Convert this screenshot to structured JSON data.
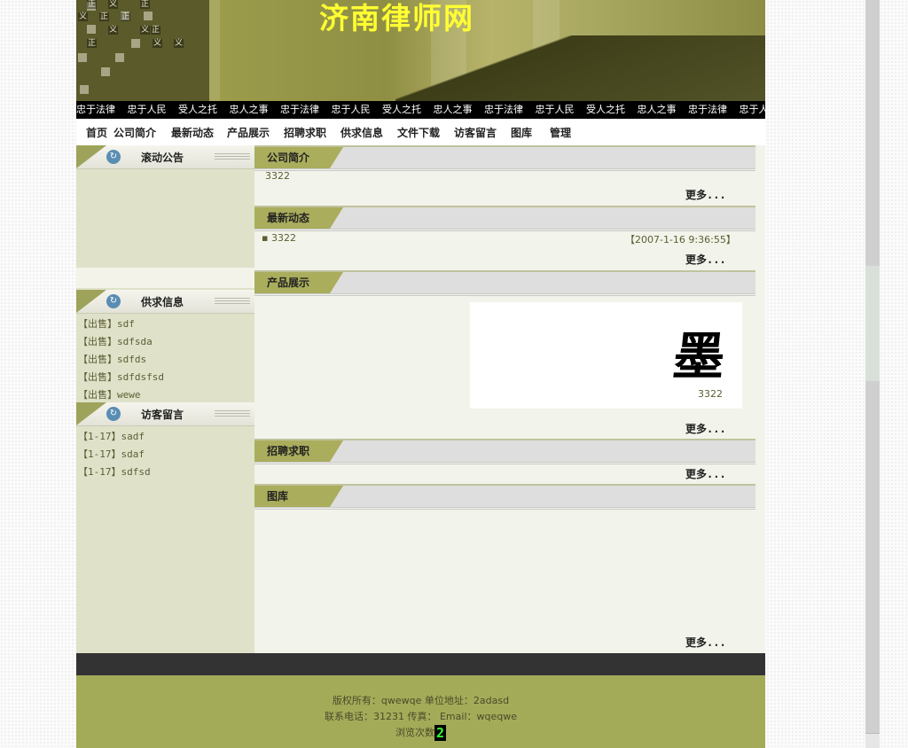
{
  "site": {
    "title": "济南律师网"
  },
  "banner": {
    "chips": [
      "正",
      "义",
      "正",
      "义",
      "正",
      "正",
      "义",
      "义",
      "正",
      "正",
      "义",
      "义"
    ]
  },
  "marquee": {
    "items": [
      "忠于法律",
      "忠于人民",
      "受人之托",
      "忠人之事",
      "忠于法律",
      "忠于人民",
      "受人之托",
      "忠人之事",
      "忠于法律",
      "忠于人民",
      "受人之托",
      "忠人之事",
      "忠于法律",
      "忠于人民",
      "受"
    ]
  },
  "nav": {
    "items": [
      "首页",
      "公司简介",
      "最新动态",
      "产品展示",
      "招聘求职",
      "供求信息",
      "文件下载",
      "访客留言",
      "图库",
      "管理"
    ]
  },
  "sidebar": {
    "notice": {
      "title": "滚动公告"
    },
    "supply": {
      "title": "供求信息",
      "items": [
        {
          "tag": "【出售】",
          "text": "sdf"
        },
        {
          "tag": "【出售】",
          "text": "sdfsda"
        },
        {
          "tag": "【出售】",
          "text": "sdfds"
        },
        {
          "tag": "【出售】",
          "text": "sdfdsfsd"
        },
        {
          "tag": "【出售】",
          "text": "wewe"
        }
      ]
    },
    "guestbook": {
      "title": "访客留言",
      "items": [
        {
          "tag": "【1-17】",
          "text": "sadf"
        },
        {
          "tag": "【1-17】",
          "text": "sdaf"
        },
        {
          "tag": "【1-17】",
          "text": "sdfsd"
        }
      ]
    }
  },
  "main": {
    "intro": {
      "title": "公司简介",
      "text": "3322",
      "more": "更多..."
    },
    "news": {
      "title": "最新动态",
      "item": "3322",
      "date": "【2007-1-16 9:36:55】",
      "more": "更多..."
    },
    "products": {
      "title": "产品展示",
      "image_char": "墨",
      "caption": "3322",
      "more": "更多..."
    },
    "jobs": {
      "title": "招聘求职",
      "more": "更多..."
    },
    "gallery": {
      "title": "图库",
      "more": "更多..."
    }
  },
  "footer": {
    "line1": "版权所有：qwewqe 单位地址：2adasd",
    "line2": "联系电话：31231  传真：  Email：wqeqwe",
    "visits_label": "浏览次数",
    "visits": "2"
  },
  "colors": {
    "accent": "#aaad5c",
    "sidebar": "#dfe2c9",
    "footer": "#a4ab58",
    "title": "#ffff33"
  }
}
